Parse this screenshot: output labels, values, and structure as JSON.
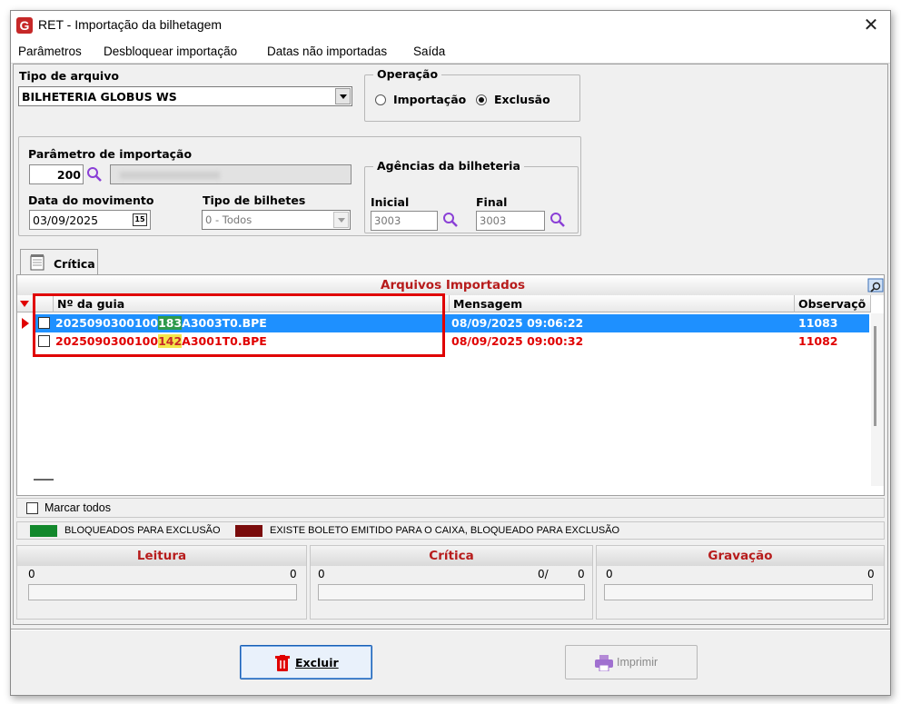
{
  "window": {
    "title": "RET - Importação da bilhetagem",
    "app_icon_letter": "G"
  },
  "menu": [
    "Parâmetros",
    "Desbloquear importação",
    "Datas não importadas",
    "Saída"
  ],
  "tipo_arquivo": {
    "label": "Tipo de arquivo",
    "value": "BILHETERIA GLOBUS WS"
  },
  "operacao": {
    "label": "Operação",
    "importacao": "Importação",
    "exclusao": "Exclusão",
    "selected": "exclusao"
  },
  "parametro": {
    "label": "Parâmetro de importação",
    "code": "200"
  },
  "data_movimento": {
    "label": "Data do movimento",
    "value": "03/09/2025",
    "cal_day": "15"
  },
  "tipo_bilhetes": {
    "label": "Tipo de bilhetes",
    "value": "0 - Todos"
  },
  "agencias": {
    "label": "Agências da bilheteria",
    "inicial_label": "Inicial",
    "inicial": "3003",
    "final_label": "Final",
    "final": "3003"
  },
  "tab": {
    "label": "Crítica"
  },
  "grid": {
    "title": "Arquivos Importados",
    "columns": [
      "Nº da guia",
      "Mensagem",
      "Observaçõ"
    ],
    "rows": [
      {
        "guia_a": "2025090300100",
        "guia_b": "183",
        "guia_c": "A3003T0.BPE",
        "mensagem": "08/09/2025 09:06:22",
        "obs": "11083"
      },
      {
        "guia_a": "2025090300100",
        "guia_b": "142",
        "guia_c": "A3001T0.BPE",
        "mensagem": "08/09/2025 09:00:32",
        "obs": "11082"
      }
    ]
  },
  "marcar_todos": "Marcar todos",
  "legend": {
    "item1": "BLOQUEADOS PARA EXCLUSÃO",
    "color1": "#12882c",
    "item2": "EXISTE BOLETO EMITIDO PARA O CAIXA, BLOQUEADO PARA EXCLUSÃO",
    "color2": "#7a0c0c"
  },
  "progress": {
    "leitura": {
      "title": "Leitura",
      "left": "0",
      "right": "0"
    },
    "critica": {
      "title": "Crítica",
      "left": "0",
      "mid": "0/",
      "right": "0"
    },
    "gravacao": {
      "title": "Gravação",
      "left": "0",
      "right": "0"
    }
  },
  "buttons": {
    "excluir": "Excluir",
    "imprimir": "Imprimir"
  }
}
